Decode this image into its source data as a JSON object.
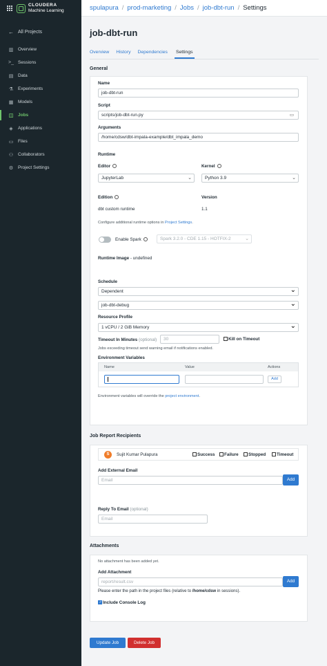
{
  "brand": {
    "line1": "CLOUDERA",
    "line2": "Machine Learning"
  },
  "sidebar": {
    "back": "All Projects",
    "items": [
      {
        "label": "Overview",
        "icon": "overview-icon",
        "glyph": "▥"
      },
      {
        "label": "Sessions",
        "icon": "terminal-icon",
        "glyph": ">_"
      },
      {
        "label": "Data",
        "icon": "data-icon",
        "glyph": "▤"
      },
      {
        "label": "Experiments",
        "icon": "flask-icon",
        "glyph": "⚗"
      },
      {
        "label": "Models",
        "icon": "model-icon",
        "glyph": "▦"
      },
      {
        "label": "Jobs",
        "icon": "jobs-icon",
        "glyph": "◫"
      },
      {
        "label": "Applications",
        "icon": "applications-icon",
        "glyph": "◈"
      },
      {
        "label": "Files",
        "icon": "files-icon",
        "glyph": "▭"
      },
      {
        "label": "Collaborators",
        "icon": "collaborators-icon",
        "glyph": "⚇"
      },
      {
        "label": "Project Settings",
        "icon": "gear-icon",
        "glyph": "⚙"
      }
    ],
    "active": "Jobs"
  },
  "breadcrumb": {
    "user": "spulapura",
    "project": "prod-marketing",
    "jobs": "Jobs",
    "job": "job-dbt-run",
    "current": "Settings"
  },
  "page": {
    "title": "job-dbt-run"
  },
  "tabs": [
    "Overview",
    "History",
    "Dependencies",
    "Settings"
  ],
  "general": {
    "heading": "General",
    "name_label": "Name",
    "name_value": "job-dbt-run",
    "script_label": "Script",
    "script_value": "scripts/job-dbt-run.py",
    "arguments_label": "Arguments",
    "arguments_value": "/home/cdsw/dbt-impala-example/dbt_impala_demo",
    "runtime_heading": "Runtime",
    "editor_label": "Editor",
    "editor_value": "JupyterLab",
    "kernel_label": "Kernel",
    "kernel_value": "Python 3.9",
    "edition_label": "Edition",
    "edition_value": "dbt custom runtime",
    "version_label": "Version",
    "version_value": "1.1",
    "configure_text": "Configure additional runtime options in ",
    "configure_link": "Project Settings",
    "configure_end": ".",
    "spark_label": "Enable Spark",
    "spark_value": "Spark 3.2.0 - CDE 1.15 - HOTFIX-2",
    "runtime_image_label": "Runtime Image",
    "runtime_image_value": " - undefined",
    "schedule_label": "Schedule",
    "schedule_value": "Dependent",
    "dependency_value": "job-dbt-debug",
    "resource_label": "Resource Profile",
    "resource_value": "1 vCPU / 2 GiB Memory",
    "timeout_label": "Timeout In Minutes",
    "timeout_optional": "(optional)",
    "timeout_placeholder": "30",
    "kill_label": "Kill on Timeout",
    "timeout_note": "Jobs exceeding timeout send warning email if notifications enabled.",
    "env_label": "Environment Variables",
    "env_cols": [
      "Name",
      "Value",
      "Actions"
    ],
    "env_add": "Add",
    "env_note": "Environment variables will override the ",
    "env_note_link": "project environment",
    "env_note_end": "."
  },
  "report": {
    "heading": "Job Report Recipients",
    "avatar_letter": "S",
    "recipient": "Sujit Kumar Pulapura",
    "checks": [
      "Success",
      "Failure",
      "Stopped",
      "Timeout"
    ],
    "external_label": "Add External Email",
    "email_placeholder": "Email",
    "add_button": "Add",
    "reply_label": "Reply To Email",
    "reply_optional": "(optional)",
    "reply_placeholder": "Email"
  },
  "attachments": {
    "heading": "Attachments",
    "none_text": "No attachment has been added yet.",
    "add_label": "Add Attachment",
    "path_placeholder": "report/result.csv",
    "add_button": "Add",
    "help_pre": "Please enter the path in the project files (relative to ",
    "help_bold": "/home/cdsw",
    "help_post": " in sessions).",
    "console_label": "Include Console Log"
  },
  "actions": {
    "update": "Update Job",
    "delete": "Delete Job"
  }
}
